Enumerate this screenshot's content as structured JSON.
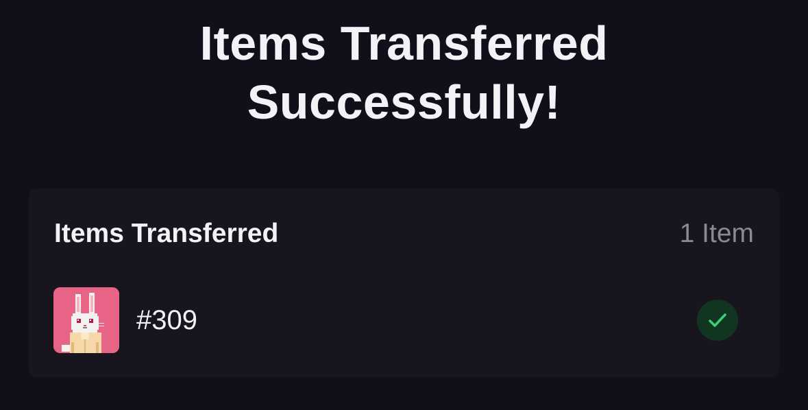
{
  "header": {
    "title_line1": "Items Transferred",
    "title_line2": "Successfully!"
  },
  "card": {
    "heading": "Items Transferred",
    "count": "1 Item",
    "items": [
      {
        "name": "#309",
        "thumbnail_icon": "pixel-bunny-icon",
        "thumbnail_bg": "#e86487",
        "status_icon": "check-icon",
        "status_color": "#3ccf78"
      }
    ]
  },
  "colors": {
    "background": "#110f19",
    "card": "#18151f",
    "text": "#f3f2f6",
    "muted": "#8c8995",
    "success_bg": "#123522",
    "success": "#3ccf78"
  }
}
